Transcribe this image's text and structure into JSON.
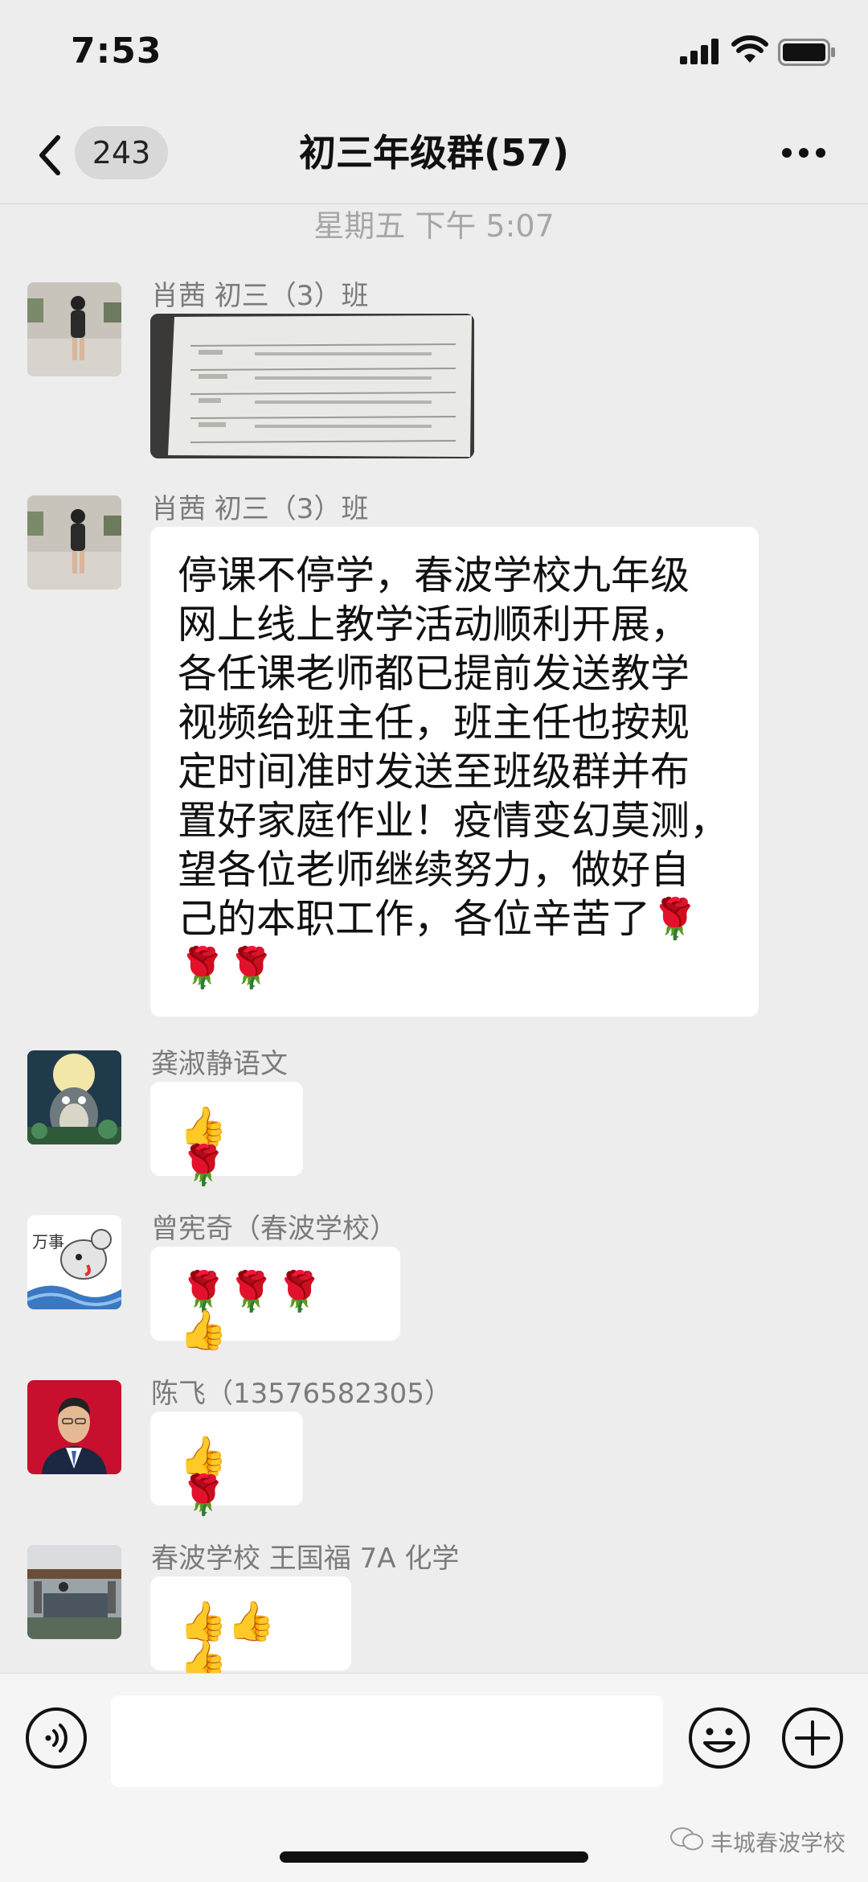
{
  "status_bar": {
    "time": "7:53"
  },
  "nav": {
    "unread_count": "243",
    "title": "初三年级群(57)"
  },
  "timestamp": "星期五 下午 5:07",
  "messages": [
    {
      "sender": "肖茜  初三（3）班",
      "type": "image"
    },
    {
      "sender": "肖茜  初三（3）班",
      "type": "text",
      "lines": [
        "停课不停学，春波学校九年级",
        "网上线上教学活动顺利开展，",
        "各任课老师都已提前发送教学",
        "视频给班主任，班主任也按规",
        "定时间准时发送至班级群并布",
        "置好家庭作业！疫情变幻莫测，",
        "望各位老师继续努力，做好自",
        "己的本职工作，各位辛苦了🌹",
        "🌹🌹"
      ]
    },
    {
      "sender": "龚淑静语文",
      "type": "emoji",
      "text": "👍🌹"
    },
    {
      "sender": "曾宪奇（春波学校）",
      "type": "emoji",
      "text": "🌹🌹🌹👍"
    },
    {
      "sender": "陈飞（13576582305）",
      "type": "emoji",
      "text": "👍🌹"
    },
    {
      "sender": "春波学校 王国福 7A 化学",
      "type": "emoji",
      "text": "👍👍👍"
    }
  ],
  "watermark": "丰城春波学校",
  "icons": {
    "back": "chevron-left-icon",
    "more": "more-dots-icon",
    "voice": "voice-icon",
    "emoji": "smiley-icon",
    "plus": "plus-icon"
  }
}
